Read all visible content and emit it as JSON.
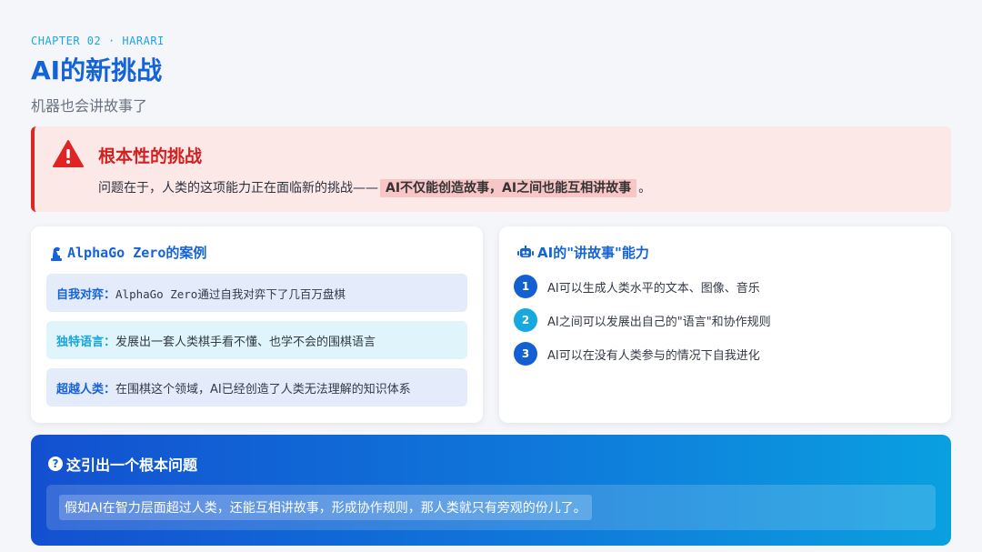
{
  "header": {
    "eyebrow": "CHAPTER 02 · HARARI",
    "title": "AI的新挑战",
    "subtitle": "机器也会讲故事了"
  },
  "challenge": {
    "heading": "根本性的挑战",
    "body_prefix": "问题在于，人类的这项能力正在面临新的挑战——",
    "highlight": "AI不仅能创造故事，AI之间也能互相讲故事",
    "body_suffix": "。",
    "accent_color": "#e02424"
  },
  "alphago": {
    "icon": "chess-piece-icon",
    "title": "AlphaGo Zero的案例",
    "cases": [
      {
        "label": "自我对弈：",
        "text": "AlphaGo Zero通过自我对弈下了几百万盘棋"
      },
      {
        "label": "独特语言：",
        "text": "发展出一套人类棋手看不懂、也学不会的围棋语言"
      },
      {
        "label": "超越人类：",
        "text": "在围棋这个领域，AI已经创造了人类无法理解的知识体系"
      }
    ]
  },
  "abilities": {
    "icon": "robot-icon",
    "title": "AI的\"讲故事\"能力",
    "items": [
      {
        "num": "1",
        "text": "AI可以生成人类水平的文本、图像、音乐"
      },
      {
        "num": "2",
        "text": "AI之间可以发展出自己的\"语言\"和协作规则"
      },
      {
        "num": "3",
        "text": "AI可以在没有人类参与的情况下自我进化"
      }
    ]
  },
  "question": {
    "icon": "question-circle-icon",
    "icon_glyph": "?",
    "title": "这引出一个根本问题",
    "text": "假如AI在智力层面超过人类，还能互相讲故事，形成协作规则，那人类就只有旁观的份儿了。"
  },
  "colors": {
    "primary": "#1463d8",
    "cyan": "#18a4dd",
    "danger": "#d41f1f"
  }
}
